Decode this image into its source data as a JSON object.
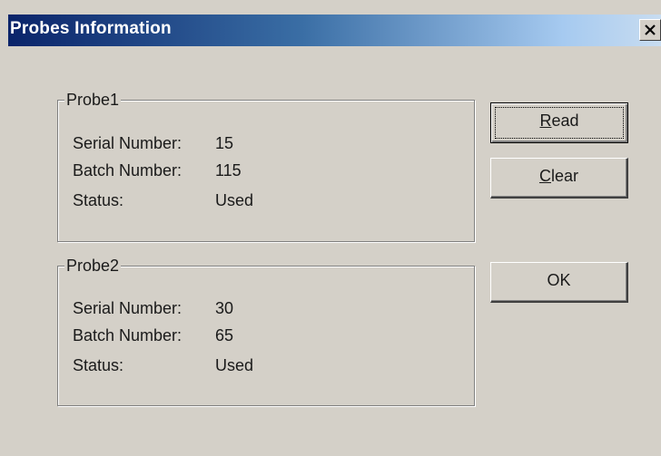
{
  "window": {
    "title": "Probes Information",
    "close_glyph": "×"
  },
  "probes": [
    {
      "name": "Probe1",
      "serial_label": "Serial Number:",
      "serial_value": "15",
      "batch_label": "Batch Number:",
      "batch_value": "115",
      "status_label": "Status:",
      "status_value": "Used"
    },
    {
      "name": "Probe2",
      "serial_label": "Serial Number:",
      "serial_value": "30",
      "batch_label": "Batch Number:",
      "batch_value": "65",
      "status_label": "Status:",
      "status_value": "Used"
    }
  ],
  "buttons": {
    "read": {
      "mnemonic": "R",
      "rest": "ead"
    },
    "clear": {
      "mnemonic": "C",
      "rest": "lear"
    },
    "ok": {
      "label": "OK"
    }
  },
  "colors": {
    "dialog_bg": "#d4d0c8",
    "title_start": "#0a246a",
    "title_end": "#a6caf0"
  }
}
